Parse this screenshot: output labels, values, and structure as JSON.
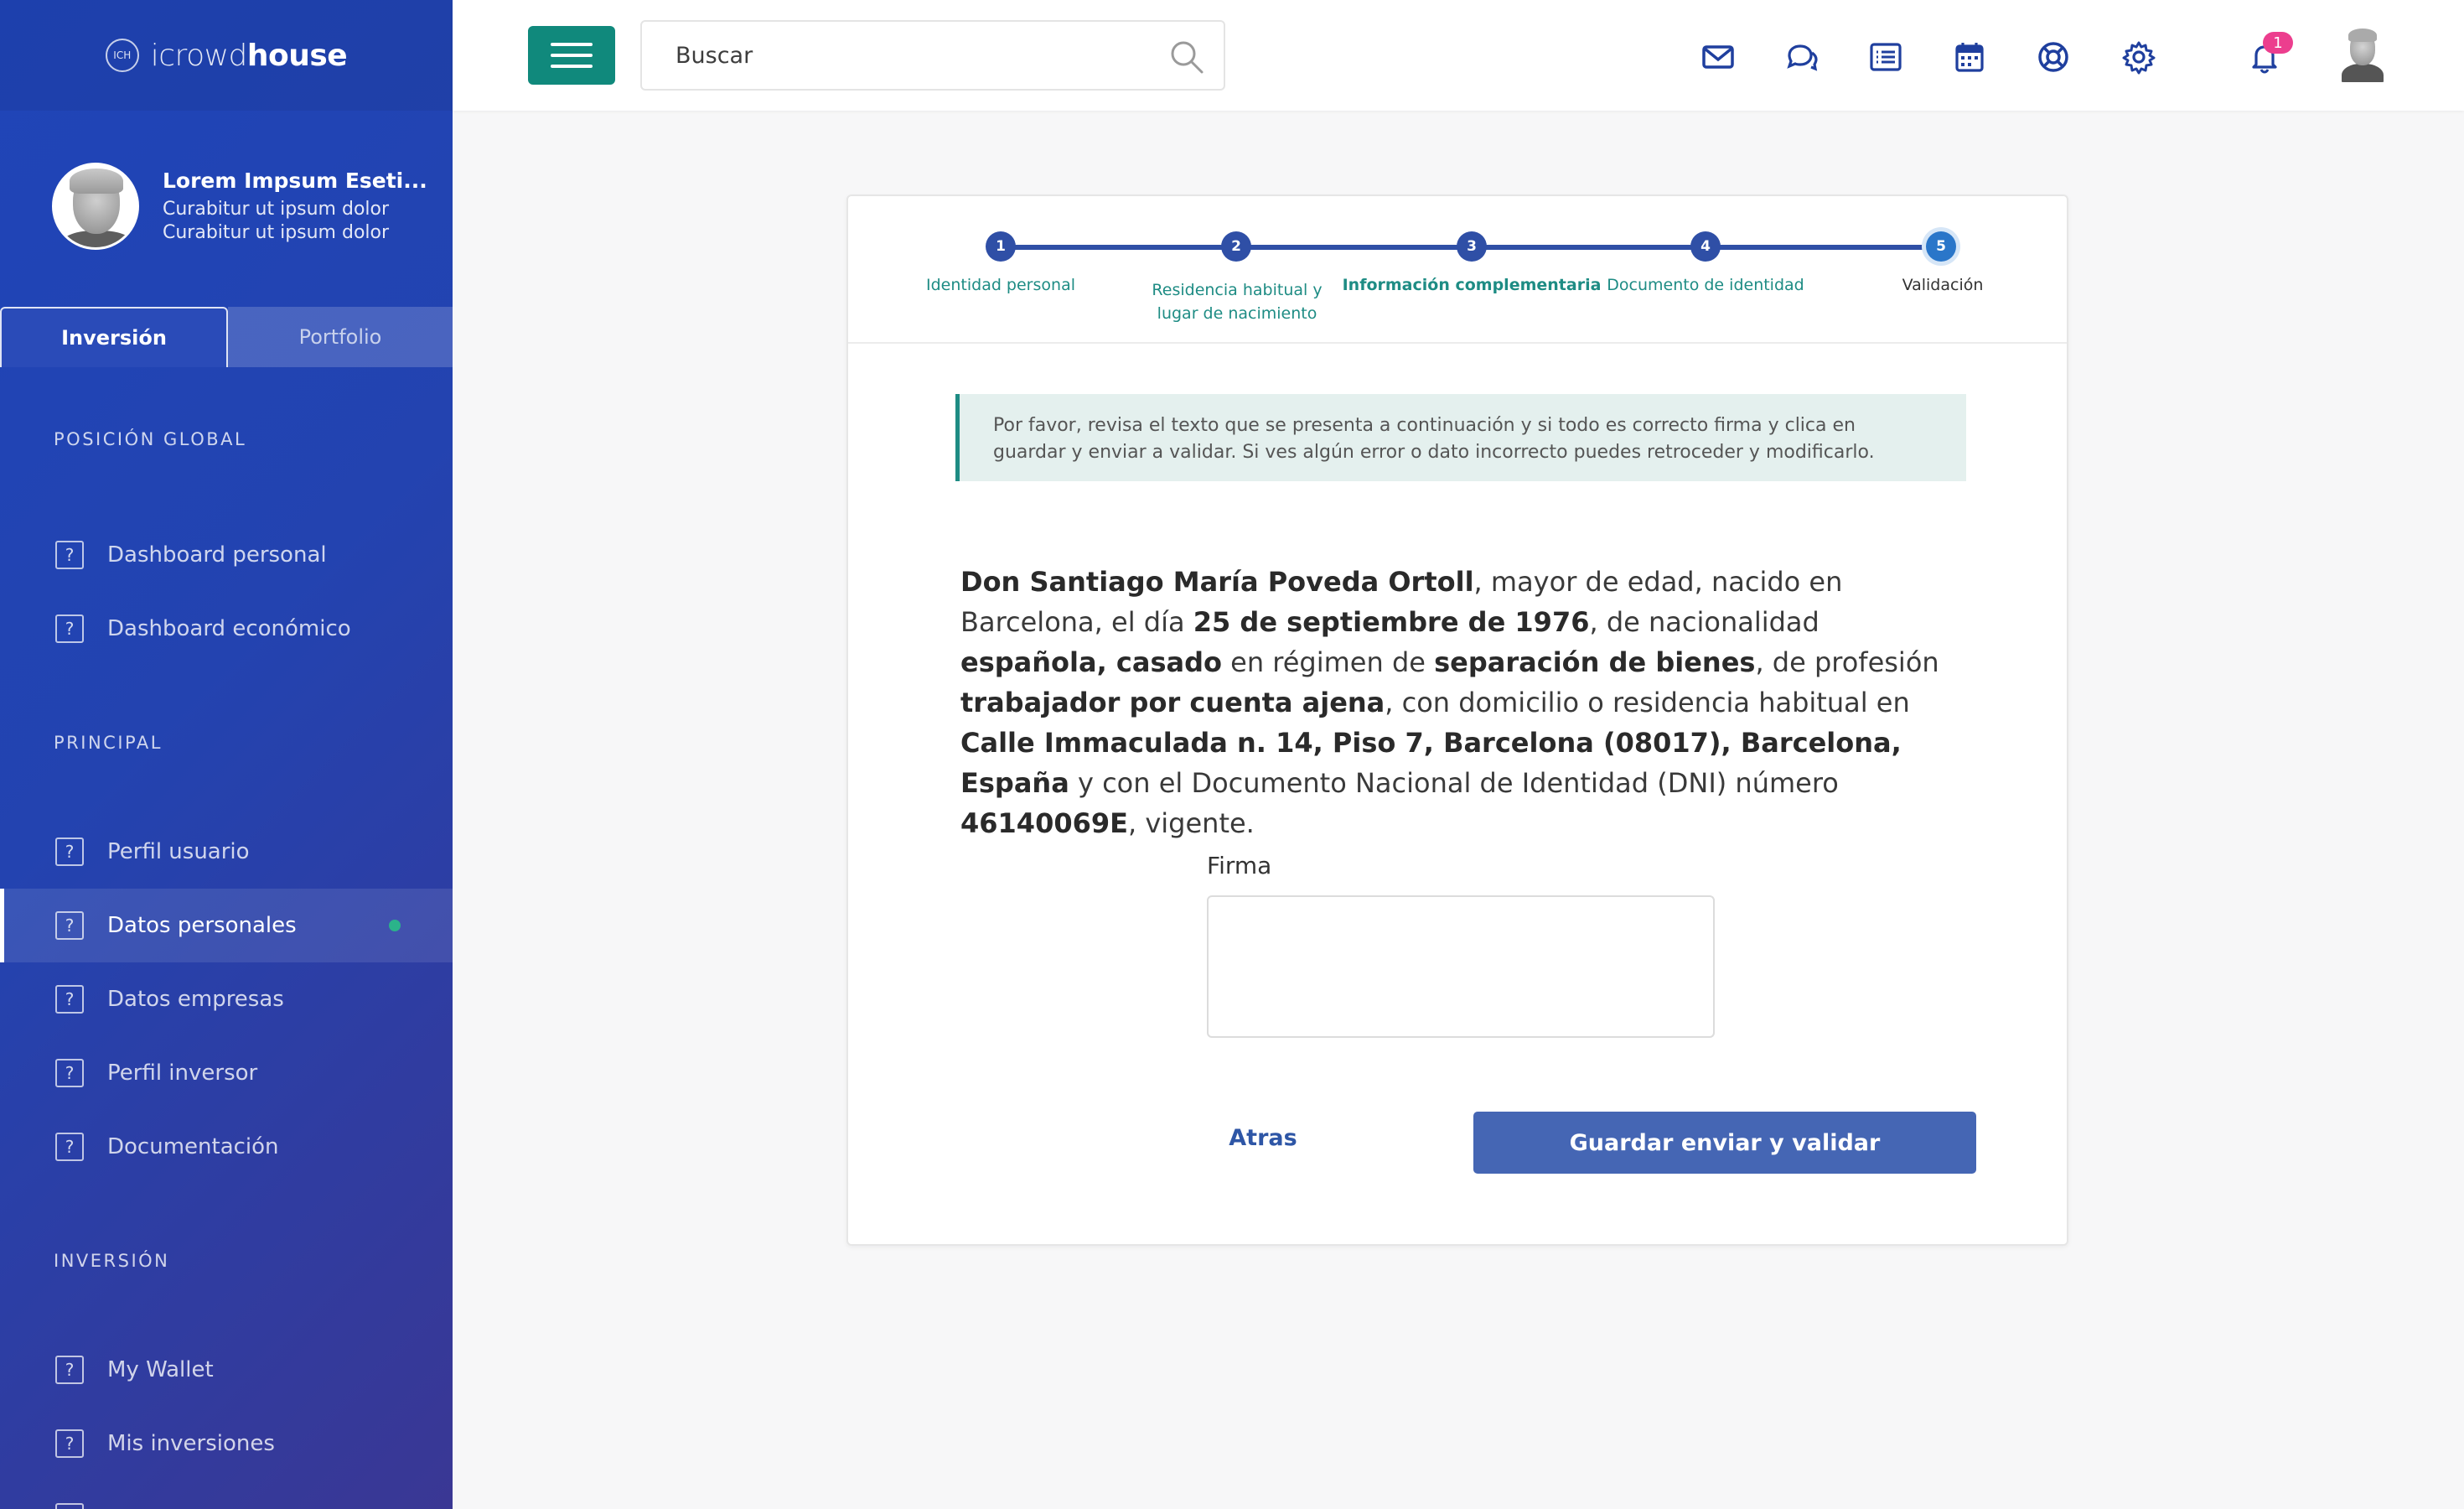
{
  "brand": {
    "mark": "ICH",
    "light": "icrowd",
    "bold": "house"
  },
  "profile": {
    "name": "Lorem Impsum Eseti...",
    "line1": "Curabitur ut ipsum dolor",
    "line2": "Curabitur ut ipsum dolor"
  },
  "sidebar_tabs": {
    "active": "Inversión",
    "inactive": "Portfolio"
  },
  "sidebar": {
    "section_global": "POSICIÓN GLOBAL",
    "section_principal": "PRINCIPAL",
    "section_inversion": "INVERSIÓN",
    "items": [
      {
        "label": "Dashboard personal",
        "icon": "help-square-icon"
      },
      {
        "label": "Dashboard económico",
        "icon": "help-square-icon"
      },
      {
        "label": "Perfil usuario",
        "icon": "help-square-icon"
      },
      {
        "label": "Datos personales",
        "icon": "help-square-icon",
        "active": true
      },
      {
        "label": "Datos empresas",
        "icon": "help-square-icon"
      },
      {
        "label": "Perfil inversor",
        "icon": "help-square-icon"
      },
      {
        "label": "Documentación",
        "icon": "help-square-icon"
      },
      {
        "label": "My Wallet",
        "icon": "help-square-icon"
      },
      {
        "label": "Mis inversiones",
        "icon": "help-square-icon"
      }
    ],
    "icon_glyph": "?"
  },
  "topbar": {
    "search_placeholder": "Buscar",
    "icons": [
      "mail-icon",
      "chat-icon",
      "list-icon",
      "calendar-icon",
      "lifebuoy-icon",
      "settings-icon",
      "bell-icon"
    ],
    "notification_count": "1"
  },
  "stepper": {
    "steps": [
      {
        "num": "1",
        "label": "Identidad personal"
      },
      {
        "num": "2",
        "label1": "Residencia habitual y",
        "label2": "lugar de nacimiento"
      },
      {
        "num": "3",
        "label": "Información complementaria"
      },
      {
        "num": "4",
        "label": "Documento de identidad"
      },
      {
        "num": "5",
        "label": "Validación"
      }
    ]
  },
  "notice": "Por favor, revisa el texto que se presenta a continuación y si todo es correcto firma y clica en guardar y enviar a validar. Si ves algún error o dato incorrecto puedes retroceder y modificarlo.",
  "legal": {
    "name": "Don Santiago María Poveda Ortoll",
    "t1": ", mayor de edad, nacido en Barcelona, el día ",
    "birthdate": "25 de septiembre de 1976",
    "t2": ", de nacionalidad ",
    "nationality": "española, casado",
    "t3": " en régimen de ",
    "regime": "separación de bienes",
    "t4": ", de profesión ",
    "profession": "trabajador por cuenta ajena",
    "t5": ", con domicilio o residencia habitual en ",
    "address": "Calle Immaculada n. 14, Piso 7, Barcelona (08017), Barcelona, España",
    "t6": " y con el Documento Nacional de Identidad (DNI) número ",
    "dni": "46140069E",
    "t7": ", vigente."
  },
  "form": {
    "firma_label": "Firma",
    "back_label": "Atras",
    "submit_label": "Guardar enviar y validar"
  },
  "colors": {
    "sidebar": "#2343b0",
    "accent_teal": "#10897c",
    "primary_button": "#4566b4",
    "step": "#2f4fa6",
    "badge": "#ec3e8e"
  }
}
